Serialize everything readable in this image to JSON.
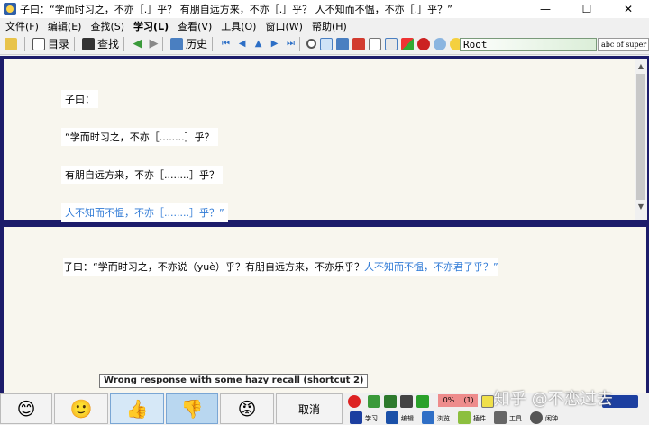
{
  "window": {
    "title": "子曰：“学而时习之，不亦［.］乎？ 有朋自远方来，不亦［.］乎？ 人不知而不愠，不亦［.］乎？”",
    "minimize": "—",
    "maximize": "☐",
    "close": "✕"
  },
  "menu": [
    {
      "label": "文件(F)"
    },
    {
      "label": "编辑(E)"
    },
    {
      "label": "查找(S)"
    },
    {
      "label": "学习(L)"
    },
    {
      "label": "查看(V)"
    },
    {
      "label": "工具(O)"
    },
    {
      "label": "窗口(W)"
    },
    {
      "label": "帮助(H)"
    }
  ],
  "toolbar": {
    "contents_label": "目录",
    "find_label": "查找",
    "history_label": "历史",
    "search_value": "Root",
    "sample_text": "abc of super"
  },
  "question": {
    "line1": "子曰：",
    "line2": "“学而时习之，不亦［........］乎？",
    "line3": "有朋自远方来，不亦［........］乎？",
    "line4": "人不知而不愠，不亦［........］乎？”"
  },
  "answer": {
    "part1": "子曰：“学而时习之，不亦说（yuè）乎？有朋自远方来，不亦乐乎？",
    "part2": "人不知而不愠，不亦君子乎？”"
  },
  "tooltip": "Wrong response with some hazy recall (shortcut 2)",
  "grades": [
    {
      "icon": "😊",
      "name": "grade-5"
    },
    {
      "icon": "🙂",
      "name": "grade-4"
    },
    {
      "icon": "👍",
      "name": "grade-3"
    },
    {
      "icon": "👎",
      "name": "grade-2"
    },
    {
      "icon": "😡",
      "name": "grade-1"
    }
  ],
  "cancel_label": "取消",
  "status": {
    "pct": "0%",
    "count": "(1)",
    "learn": "学习",
    "edit": "编辑",
    "browse": "浏览",
    "plugin": "插件",
    "tools": "工具",
    "misc": "闲钟"
  },
  "watermark": "知乎 @不恋过去",
  "colors": {
    "pane_border": "#1c1c6a",
    "pane_bg": "#f8f6ee",
    "link_blue": "#2f7ad6"
  }
}
